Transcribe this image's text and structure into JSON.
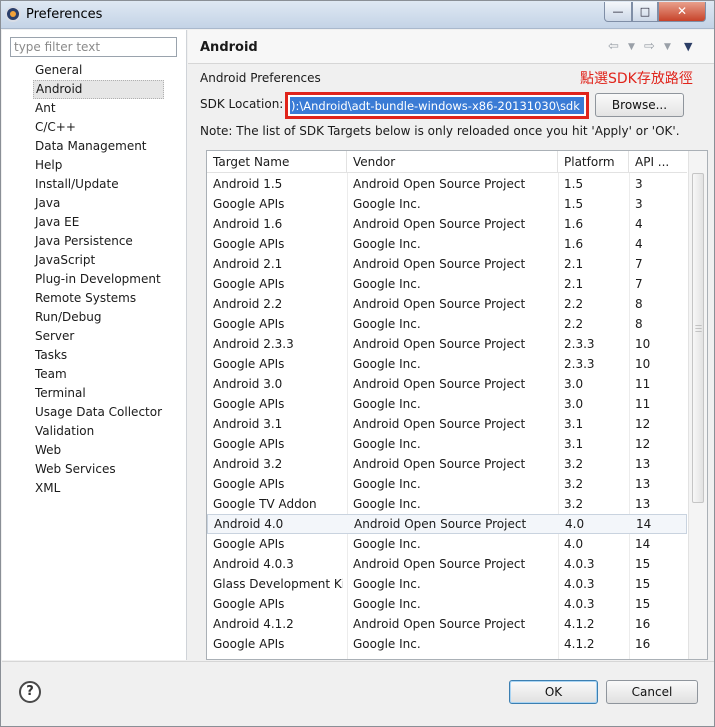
{
  "window": {
    "title": "Preferences",
    "minimize_icon": "minimize-icon",
    "maximize_icon": "maximize-icon",
    "close_icon": "close-icon"
  },
  "sidebar": {
    "filter_placeholder": "type filter text",
    "items": [
      {
        "label": "General"
      },
      {
        "label": "Android",
        "selected": true
      },
      {
        "label": "Ant"
      },
      {
        "label": "C/C++"
      },
      {
        "label": "Data Management"
      },
      {
        "label": "Help"
      },
      {
        "label": "Install/Update"
      },
      {
        "label": "Java"
      },
      {
        "label": "Java EE"
      },
      {
        "label": "Java Persistence"
      },
      {
        "label": "JavaScript"
      },
      {
        "label": "Plug-in Development"
      },
      {
        "label": "Remote Systems"
      },
      {
        "label": "Run/Debug"
      },
      {
        "label": "Server"
      },
      {
        "label": "Tasks"
      },
      {
        "label": "Team"
      },
      {
        "label": "Terminal"
      },
      {
        "label": "Usage Data Collector"
      },
      {
        "label": "Validation"
      },
      {
        "label": "Web"
      },
      {
        "label": "Web Services"
      },
      {
        "label": "XML"
      }
    ]
  },
  "page": {
    "title": "Android",
    "section_label": "Android Preferences",
    "annotation": "點選SDK存放路徑",
    "sdk_label": "SDK Location:",
    "sdk_value": "):\\Android\\adt-bundle-windows-x86-20131030\\sdk",
    "browse_label": "Browse...",
    "note": "Note: The list of SDK Targets below is only reloaded once you hit 'Apply' or 'OK'."
  },
  "table": {
    "headers": [
      "Target Name",
      "Vendor",
      "Platform",
      "API ..."
    ],
    "rows": [
      [
        "Android 1.5",
        "Android Open Source Project",
        "1.5",
        "3"
      ],
      [
        "Google APIs",
        "Google Inc.",
        "1.5",
        "3"
      ],
      [
        "Android 1.6",
        "Android Open Source Project",
        "1.6",
        "4"
      ],
      [
        "Google APIs",
        "Google Inc.",
        "1.6",
        "4"
      ],
      [
        "Android 2.1",
        "Android Open Source Project",
        "2.1",
        "7"
      ],
      [
        "Google APIs",
        "Google Inc.",
        "2.1",
        "7"
      ],
      [
        "Android 2.2",
        "Android Open Source Project",
        "2.2",
        "8"
      ],
      [
        "Google APIs",
        "Google Inc.",
        "2.2",
        "8"
      ],
      [
        "Android 2.3.3",
        "Android Open Source Project",
        "2.3.3",
        "10"
      ],
      [
        "Google APIs",
        "Google Inc.",
        "2.3.3",
        "10"
      ],
      [
        "Android 3.0",
        "Android Open Source Project",
        "3.0",
        "11"
      ],
      [
        "Google APIs",
        "Google Inc.",
        "3.0",
        "11"
      ],
      [
        "Android 3.1",
        "Android Open Source Project",
        "3.1",
        "12"
      ],
      [
        "Google APIs",
        "Google Inc.",
        "3.1",
        "12"
      ],
      [
        "Android 3.2",
        "Android Open Source Project",
        "3.2",
        "13"
      ],
      [
        "Google APIs",
        "Google Inc.",
        "3.2",
        "13"
      ],
      [
        "Google TV Addon",
        "Google Inc.",
        "3.2",
        "13"
      ],
      [
        "Android 4.0",
        "Android Open Source Project",
        "4.0",
        "14"
      ],
      [
        "Google APIs",
        "Google Inc.",
        "4.0",
        "14"
      ],
      [
        "Android 4.0.3",
        "Android Open Source Project",
        "4.0.3",
        "15"
      ],
      [
        "Glass Development Ki...",
        "Google Inc.",
        "4.0.3",
        "15"
      ],
      [
        "Google APIs",
        "Google Inc.",
        "4.0.3",
        "15"
      ],
      [
        "Android 4.1.2",
        "Android Open Source Project",
        "4.1.2",
        "16"
      ],
      [
        "Google APIs",
        "Google Inc.",
        "4.1.2",
        "16"
      ]
    ],
    "selected_row": 17
  },
  "footer": {
    "help_label": "?",
    "ok_label": "OK",
    "cancel_label": "Cancel"
  },
  "colors": {
    "annotation": "#e0241b",
    "selection": "#3a7bd5"
  }
}
